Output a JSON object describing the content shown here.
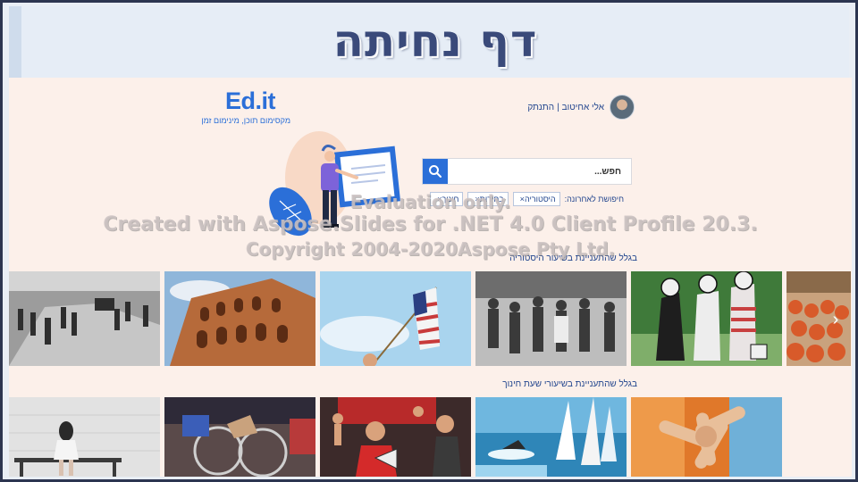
{
  "slide": {
    "title": "דף נחיתה"
  },
  "header": {
    "logo_mark": "Ed.it",
    "logo_tagline": "מקסימום תוכן, מינימום זמן",
    "user_name": "אלי אחיטוב",
    "separator": "|",
    "logout_label": "התנתק"
  },
  "search": {
    "placeholder": "חפש...",
    "recent_label": "חיפושת לאחרונה:",
    "recent_chips": [
      "היסטוריה",
      "בחירות",
      "חינוך"
    ]
  },
  "sections": [
    {
      "title": "בגלל שהתעניינת בשיעור היסטוריה",
      "thumbnails": [
        "soldiers-column",
        "colosseum",
        "us-flag",
        "crowd-march",
        "political-cartoon",
        "red-crowd"
      ]
    },
    {
      "title": "בגלל שהתעניינת בשיעורי שעת חינוך",
      "thumbnails": [
        "sad-girl-bench",
        "wheelchair-race",
        "protest-megaphone",
        "sailboats",
        "hands-together"
      ]
    }
  ],
  "watermark": {
    "line1": "Evaluation only.",
    "line2": "Created with Aspose.Slides for .NET 4.0 Client Profile 20.3.",
    "line3": "Copyright 2004-2020Aspose Pty Ltd."
  },
  "icons": {
    "search": "search-icon",
    "next": "chevron-right-icon"
  },
  "colors": {
    "accent": "#2b6fd8",
    "page_bg": "#fcf0ea",
    "title": "#3a4a7a",
    "link": "#24478f"
  }
}
